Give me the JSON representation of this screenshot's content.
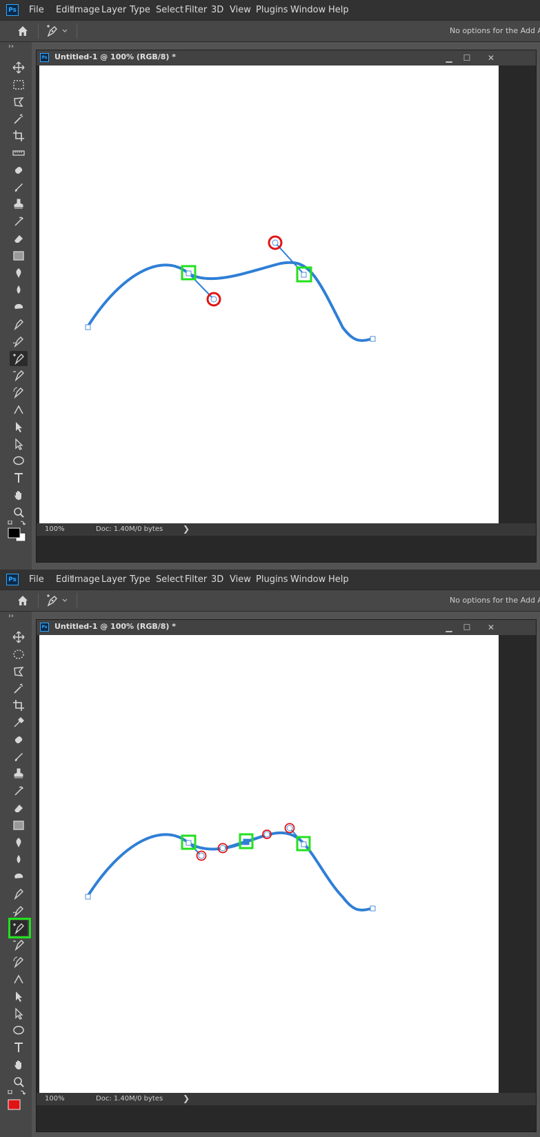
{
  "menubar": {
    "logo": "Ps",
    "items": [
      "File",
      "Edit",
      "Image",
      "Layer",
      "Type",
      "Select",
      "Filter",
      "3D",
      "View",
      "Plugins",
      "Window",
      "Help"
    ]
  },
  "options_bar": {
    "text": "No options for the Add Anchor Point tool.",
    "tool_icon": "add-anchor-point-icon",
    "home_icon": "home-icon"
  },
  "document": {
    "logo": "Ps",
    "title": "Untitled-1 @ 100% (RGB/8) *",
    "controls": [
      "minimize-icon",
      "maximize-icon",
      "close-icon"
    ],
    "status_zoom": "100%",
    "status_doc": "Doc: 1.40M/0 bytes",
    "status_arrow": "❯"
  },
  "toolbar": {
    "collapse": "››",
    "tools": [
      "move-icon",
      "marquee-icon",
      "lasso-icon",
      "magic-wand-icon",
      "crop-icon",
      "eyedropper-icon",
      "healing-icon",
      "brush-icon",
      "stamp-icon",
      "history-brush-icon",
      "eraser-icon",
      "gradient-icon",
      "smudge-icon",
      "dodge-icon",
      "sponge-icon",
      "pen-icon",
      "freeform-pen-icon",
      "add-anchor-point-icon",
      "delete-anchor-point-icon",
      "curvature-pen-icon",
      "convert-point-icon",
      "path-selection-icon",
      "direct-selection-icon",
      "ellipse-icon",
      "type-icon",
      "hand-icon",
      "zoom-icon"
    ],
    "active_tool": "add-anchor-point-icon"
  },
  "colors": {
    "path": "#2f7fd6",
    "anchor_highlight": "#22e01e",
    "handle_highlight": "#e01414",
    "foreground_top": "#000000",
    "foreground_bottom": "#e01414"
  }
}
